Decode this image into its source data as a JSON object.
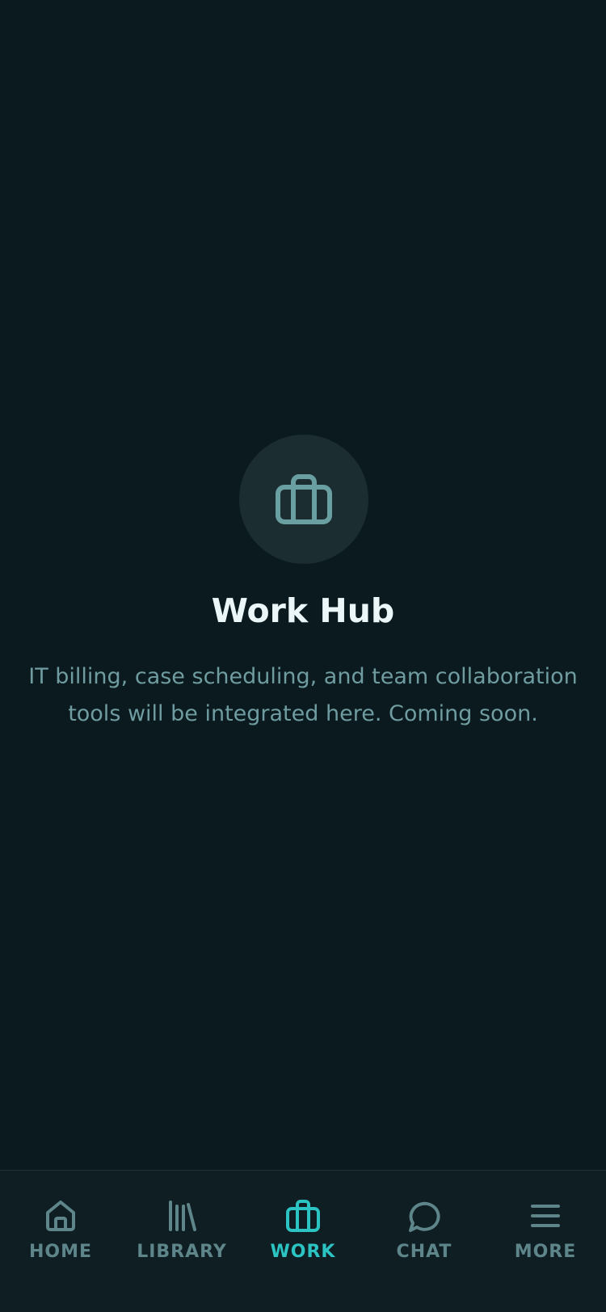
{
  "main": {
    "icon": "briefcase-icon",
    "title": "Work Hub",
    "subtitle": "IT billing, case scheduling, and team collaboration tools will be integrated here. Coming soon."
  },
  "tabbar": {
    "items": [
      {
        "label": "HOME",
        "icon": "home-icon",
        "active": false
      },
      {
        "label": "LIBRARY",
        "icon": "library-icon",
        "active": false
      },
      {
        "label": "WORK",
        "icon": "briefcase-icon",
        "active": true
      },
      {
        "label": "CHAT",
        "icon": "chat-bubble-icon",
        "active": false
      },
      {
        "label": "MORE",
        "icon": "menu-icon",
        "active": false
      }
    ]
  },
  "colors": {
    "background": "#0b1a1e",
    "accent": "#2cc3c3",
    "muted": "#5d858a",
    "title": "#eaf6f7"
  }
}
